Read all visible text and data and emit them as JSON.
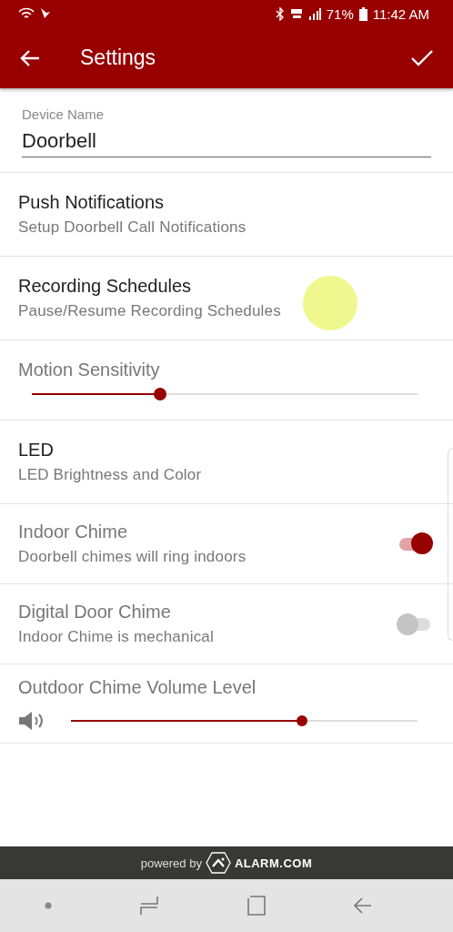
{
  "status_bar": {
    "battery": "71%",
    "time": "11:42 AM"
  },
  "app_bar": {
    "title": "Settings"
  },
  "device_name": {
    "label": "Device Name",
    "value": "Doorbell"
  },
  "rows": [
    {
      "kind": "link",
      "title": "Push Notifications",
      "subtitle": "Setup Doorbell Call Notifications"
    },
    {
      "kind": "link",
      "title": "Recording Schedules",
      "subtitle": "Pause/Resume Recording Schedules"
    },
    {
      "kind": "slider",
      "title": "Motion Sensitivity",
      "level": 0.333
    },
    {
      "kind": "link",
      "title": "LED",
      "subtitle": "LED Brightness and Color"
    },
    {
      "kind": "toggle",
      "title": "Indoor Chime",
      "subtitle": "Doorbell chimes will ring indoors",
      "on": true
    },
    {
      "kind": "toggle",
      "title": "Digital Door Chime",
      "subtitle": "Indoor Chime is mechanical",
      "on": false
    },
    {
      "kind": "volume",
      "title": "Outdoor Chime Volume Level",
      "level": 0.667
    }
  ],
  "footer": {
    "prefix": "powered by",
    "brand": "ALARM.COM"
  }
}
